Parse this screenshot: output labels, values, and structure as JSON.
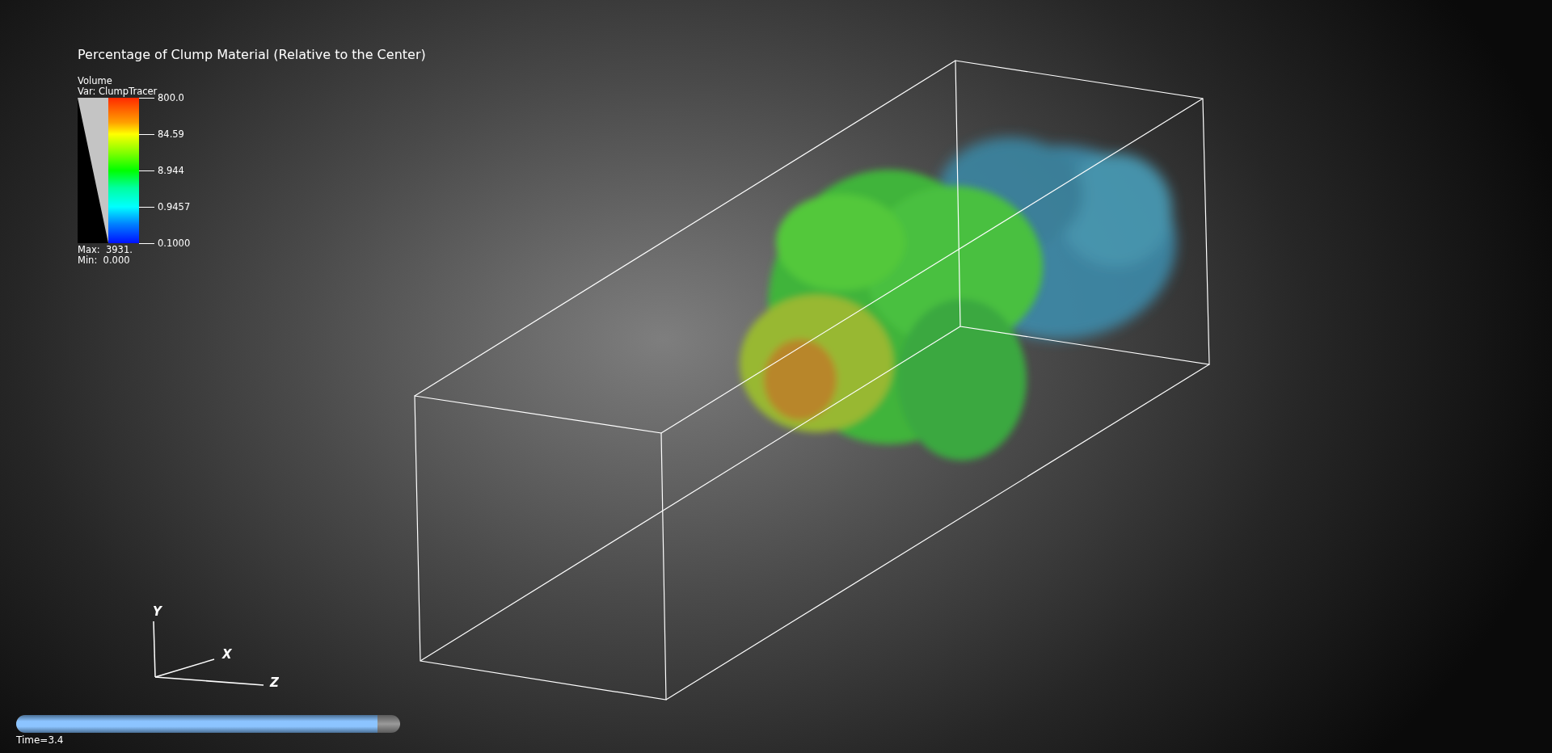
{
  "title": "Percentage of Clump Material (Relative to the Center)",
  "legend": {
    "plot_type": "Volume",
    "variable": "Var: ClumpTracer",
    "ticks": [
      "800.0",
      "84.59",
      "8.944",
      "0.9457",
      "0.1000"
    ],
    "max": "Max:  3931.",
    "min": "Min:  0.000"
  },
  "axes": {
    "x": "X",
    "y": "Y",
    "z": "Z"
  },
  "time_slider": {
    "level": 0.94,
    "label": "Time=3.4"
  }
}
